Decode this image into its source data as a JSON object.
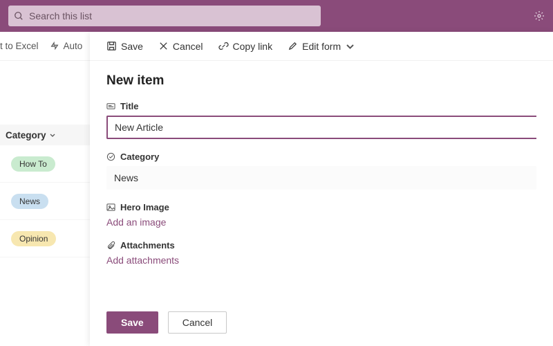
{
  "topbar": {
    "search_placeholder": "Search this list"
  },
  "background_cmdbar": {
    "excel_fragment": "t to Excel",
    "automate_fragment": "Auto"
  },
  "left": {
    "category_header": "Category",
    "pills": [
      "How To",
      "News",
      "Opinion"
    ]
  },
  "panel": {
    "toolbar": {
      "save": "Save",
      "cancel": "Cancel",
      "copy_link": "Copy link",
      "edit_form": "Edit form"
    },
    "title": "New item",
    "fields": {
      "title_label": "Title",
      "title_value": "New Article",
      "category_label": "Category",
      "category_value": "News",
      "hero_label": "Hero Image",
      "hero_action": "Add an image",
      "attachments_label": "Attachments",
      "attachments_action": "Add attachments"
    },
    "footer": {
      "save": "Save",
      "cancel": "Cancel"
    }
  }
}
